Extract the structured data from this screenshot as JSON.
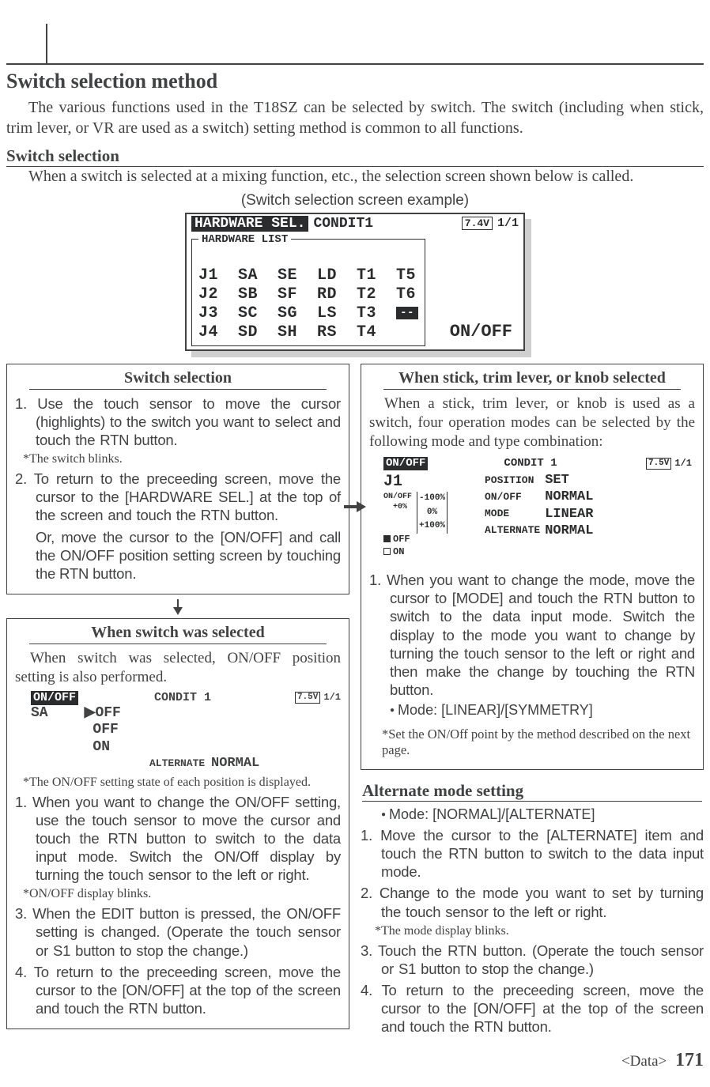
{
  "title": "Switch selection method",
  "intro": "The various functions used in the T18SZ can be selected by switch. The switch (including when stick, trim lever, or VR are used as a switch) setting method is common to all functions.",
  "sec1_title": "Switch selection",
  "sec1_body": "When a switch is selected at a mixing function, etc., the selection screen shown below is called.",
  "lcd_caption": "(Switch selection screen example)",
  "lcd_main": {
    "hdr_inv": "HARDWARE SEL.",
    "hdr_cond": "CONDIT1",
    "batt": "7.4V",
    "page": "1/1",
    "legend": "HARDWARE LIST",
    "rows": [
      "J1  SA  SE  LD  T1  T5",
      "J2  SB  SF  RD  T2  T6",
      "J3  SC  SG  LS  T3  ",
      "J4  SD  SH  RS  T4"
    ],
    "slot": "--",
    "onoff": "ON/OFF"
  },
  "left_boxA": {
    "title": "Switch selection",
    "step1": "1. Use the touch sensor to move the cursor (highlights) to the switch you want to select and touch the RTN button.",
    "note1": "*The switch blinks.",
    "step2": "2. To return to the preceeding screen, move the cursor to the [HARDWARE SEL.] at the top of the screen and touch the RTN button.",
    "step2b": "Or, move the cursor to the [ON/OFF] and call the ON/OFF position setting screen by touching the RTN button."
  },
  "left_boxB": {
    "title": "When switch was selected",
    "intro": "When switch was selected, ON/OFF position setting is also performed.",
    "lcd": {
      "hdr_inv": "ON/OFF",
      "hdr_cond": "CONDIT 1",
      "batt": "7.5V",
      "page": "1/1",
      "label": "SA",
      "r1": "▶OFF",
      "r2": " OFF",
      "r3": " ON",
      "alt_k": "ALTERNATE",
      "alt_v": "NORMAL"
    },
    "note1": "*The ON/OFF setting state of each position is displayed.",
    "step1": "1. When you want to change the ON/OFF setting, use the touch sensor to move the cursor and touch the RTN button to switch to the data input mode. Switch the ON/Off display by turning the touch sensor to the left or right.",
    "note2": "*ON/OFF display blinks.",
    "step3": "3. When the EDIT button is pressed, the ON/OFF setting is changed. (Operate the touch sensor or S1 button to stop the change.)",
    "step4": "4. To return to the preceeding screen, move the cursor to the [ON/OFF] at the top of the screen and touch the RTN button."
  },
  "right_boxA": {
    "title": "When stick, trim lever, or knob selected",
    "intro": "When a stick, trim lever, or knob is used as a switch, four operation modes can be selected by the following mode and type combination:",
    "lcd": {
      "hdr_inv": "ON/OFF",
      "hdr_cond": "CONDIT 1",
      "batt": "7.5V",
      "page": "1/1",
      "j": " J1",
      "top_pct": "-100%",
      "mid_pct": "0%",
      "bot_pct": "+100%",
      "onoff_pct": "ON/OFF\n  +0%",
      "off_lbl": "OFF",
      "on_lbl": "ON",
      "k_pos": "POSITION",
      "v_pos": "SET",
      "k_onoff": "ON/OFF",
      "v_onoff": "NORMAL",
      "k_mode": "MODE",
      "v_mode": "LINEAR",
      "k_alt": "ALTERNATE",
      "v_alt": "NORMAL"
    },
    "step1": "1. When you want to change the mode, move the cursor to [MODE] and touch the RTN button to switch to the data input mode. Switch the display to the mode you want to change by turning the touch sensor to the left or right and then make the change by touching the RTN button.",
    "bullet1": "Mode: [LINEAR]/[SYMMETRY]",
    "note1": "*Set the ON/Off point by the method described on the next page."
  },
  "alt": {
    "title": "Alternate mode setting",
    "bullet1": "Mode: [NORMAL]/[ALTERNATE]",
    "step1": "1. Move the cursor to the [ALTERNATE] item and touch the RTN button to switch to the data input mode.",
    "step2": "2. Change to the mode you want to set by turning the touch sensor to the left or right.",
    "note1": "*The mode display blinks.",
    "step3": "3. Touch the RTN button. (Operate the touch sensor or S1 button to stop the change.)",
    "step4": "4. To return to the preceeding screen, move the cursor to the [ON/OFF] at the top of the screen and touch the RTN button."
  },
  "footer_label": "<Data>",
  "footer_page": "171"
}
